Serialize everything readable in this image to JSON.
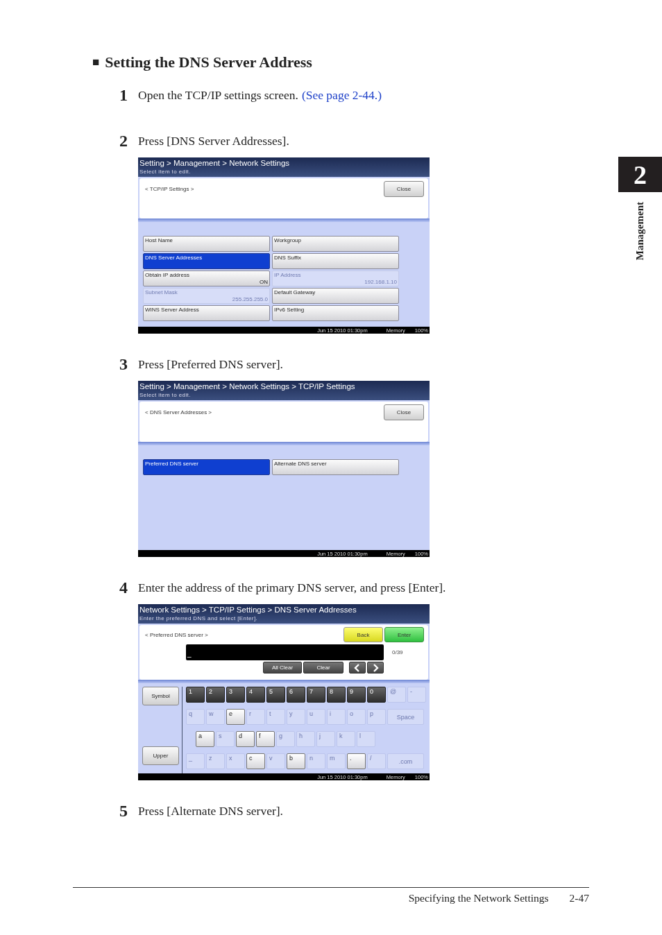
{
  "heading": {
    "bullet": "■",
    "text": "Setting the DNS Server Address"
  },
  "steps": [
    {
      "number": "1",
      "text": "Open the TCP/IP settings screen.",
      "link": "(See page 2-44.)"
    },
    {
      "number": "2",
      "text": "Press [DNS Server Addresses].",
      "screen": {
        "kind": "menu",
        "title": "Setting > Management > Network Settings",
        "subtitle": "Select item to edit.",
        "section": "< TCP/IP Settings >",
        "close_button": "Close",
        "items": [
          {
            "label": "Host Name",
            "selected": false,
            "disabled": false
          },
          {
            "label": "Workgroup",
            "selected": false,
            "disabled": false
          },
          {
            "label": "DNS Server Addresses",
            "selected": true,
            "disabled": false
          },
          {
            "label": "DNS Suffix",
            "selected": false,
            "disabled": false
          },
          {
            "label": "Obtain IP address",
            "value": "ON",
            "selected": false,
            "disabled": false
          },
          {
            "label": "IP Address",
            "value": "192.168.1.10",
            "selected": false,
            "disabled": true
          },
          {
            "label": "Subnet Mask",
            "value": "255.255.255.0",
            "selected": false,
            "disabled": true
          },
          {
            "label": "Default Gateway",
            "selected": false,
            "disabled": false
          },
          {
            "label": "WINS Server Address",
            "selected": false,
            "disabled": false
          },
          {
            "label": "IPv6 Setting",
            "selected": false,
            "disabled": false
          }
        ],
        "status": {
          "datetime": "Jun 15 2010 01:30pm",
          "memory_label": "Memory",
          "memory_value": "100%"
        }
      }
    },
    {
      "number": "3",
      "text": "Press [Preferred DNS server].",
      "screen": {
        "kind": "menu",
        "title": "Setting > Management > Network Settings > TCP/IP Settings",
        "subtitle": "Select item to edit.",
        "section": "< DNS Server Addresses >",
        "close_button": "Close",
        "items": [
          {
            "label": "Preferred DNS server",
            "selected": true,
            "disabled": false
          },
          {
            "label": "Alternate DNS server",
            "selected": false,
            "disabled": false
          }
        ],
        "status": {
          "datetime": "Jun 15 2010 01:30pm",
          "memory_label": "Memory",
          "memory_value": "100%"
        }
      }
    },
    {
      "number": "4",
      "text": "Enter the address of the primary DNS server, and press [Enter].",
      "screen": {
        "kind": "keyboard",
        "title": "Network Settings > TCP/IP Settings > DNS Server Addresses",
        "subtitle": "Enter the preferred DNS and select [Enter].",
        "section": "< Preferred DNS server >",
        "back_button": "Back",
        "enter_button": "Enter",
        "cursor": "_",
        "counter": "0/39",
        "edit_buttons": [
          "All Clear",
          "Clear"
        ],
        "side_buttons": [
          "Symbol",
          "Upper"
        ],
        "key_rows": [
          {
            "kind": "number",
            "keys": [
              {
                "label": "1",
                "disabled": false
              },
              {
                "label": "2",
                "disabled": false
              },
              {
                "label": "3",
                "disabled": false
              },
              {
                "label": "4",
                "disabled": false
              },
              {
                "label": "5",
                "disabled": false
              },
              {
                "label": "6",
                "disabled": false
              },
              {
                "label": "7",
                "disabled": false
              },
              {
                "label": "8",
                "disabled": false
              },
              {
                "label": "9",
                "disabled": false
              },
              {
                "label": "0",
                "disabled": false
              },
              {
                "label": "@",
                "disabled": true
              },
              {
                "label": "-",
                "disabled": true
              }
            ]
          },
          {
            "kind": "letter",
            "keys": [
              {
                "label": "q",
                "disabled": true
              },
              {
                "label": "w",
                "disabled": true
              },
              {
                "label": "e",
                "disabled": false
              },
              {
                "label": "r",
                "disabled": true
              },
              {
                "label": "t",
                "disabled": true
              },
              {
                "label": "y",
                "disabled": true
              },
              {
                "label": "u",
                "disabled": true
              },
              {
                "label": "i",
                "disabled": true
              },
              {
                "label": "o",
                "disabled": true
              },
              {
                "label": "p",
                "disabled": true
              }
            ],
            "wide_key": {
              "label": "Space",
              "disabled": true
            }
          },
          {
            "kind": "indented",
            "keys": [
              {
                "label": "a",
                "disabled": false
              },
              {
                "label": "s",
                "disabled": true
              },
              {
                "label": "d",
                "disabled": false
              },
              {
                "label": "f",
                "disabled": false
              },
              {
                "label": "g",
                "disabled": true
              },
              {
                "label": "h",
                "disabled": true
              },
              {
                "label": "j",
                "disabled": true
              },
              {
                "label": "k",
                "disabled": true
              },
              {
                "label": "l",
                "disabled": true
              }
            ]
          },
          {
            "kind": "letter",
            "keys": [
              {
                "label": "_",
                "disabled": true
              },
              {
                "label": "z",
                "disabled": true
              },
              {
                "label": "x",
                "disabled": true
              },
              {
                "label": "c",
                "disabled": false
              },
              {
                "label": "v",
                "disabled": true
              },
              {
                "label": "b",
                "disabled": false
              },
              {
                "label": "n",
                "disabled": true
              },
              {
                "label": "m",
                "disabled": true
              },
              {
                "label": ".",
                "disabled": false
              },
              {
                "label": "/",
                "disabled": true
              }
            ],
            "wide_key": {
              "label": ".com",
              "disabled": true
            }
          }
        ],
        "status": {
          "datetime": "Jun 15 2010 01:30pm",
          "memory_label": "Memory",
          "memory_value": "100%"
        }
      }
    },
    {
      "number": "5",
      "text": "Press [Alternate DNS server]."
    }
  ],
  "side_tab": {
    "chapter": "2",
    "label": "Management"
  },
  "footer": {
    "title": "Specifying the Network Settings",
    "page": "2-47"
  }
}
